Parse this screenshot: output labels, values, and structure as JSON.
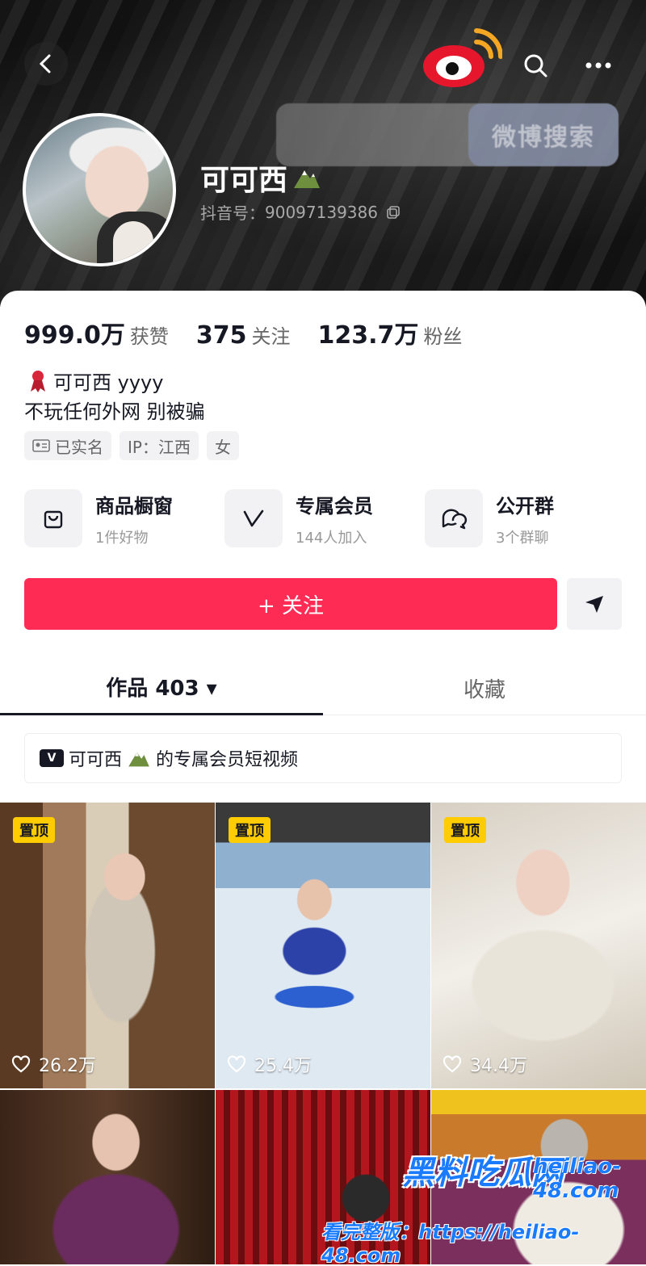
{
  "header": {
    "weibo_search_label": "微博搜索",
    "username": "可可西",
    "douyin_id_label": "抖音号：",
    "douyin_id": "90097139386"
  },
  "stats": [
    {
      "num": "999.0万",
      "label": "获赞"
    },
    {
      "num": "375",
      "label": "关注"
    },
    {
      "num": "123.7万",
      "label": "粉丝"
    }
  ],
  "bio": {
    "line1": "可可西 yyyy",
    "line2": "不玩任何外网 别被骗"
  },
  "tags": [
    "已实名",
    "IP：江西",
    "女"
  ],
  "features": [
    {
      "title": "商品橱窗",
      "sub": "1件好物",
      "icon": "shopping-bag-icon"
    },
    {
      "title": "专属会员",
      "sub": "144人加入",
      "icon": "vip-v-icon"
    },
    {
      "title": "公开群",
      "sub": "3个群聊",
      "icon": "chat-group-icon"
    }
  ],
  "actions": {
    "follow_label": "+ 关注"
  },
  "tabs": {
    "works": "作品 403 ▾",
    "favorites": "收藏"
  },
  "member_banner": {
    "badge": "V",
    "name": "可可西",
    "suffix": "的专属会员短视频"
  },
  "videos": [
    {
      "pinned": "置顶",
      "likes": "26.2万"
    },
    {
      "pinned": "置顶",
      "likes": "25.4万"
    },
    {
      "pinned": "置顶",
      "likes": "34.4万"
    },
    {
      "pinned": "",
      "likes": ""
    },
    {
      "pinned": "",
      "likes": ""
    },
    {
      "pinned": "",
      "likes": ""
    }
  ],
  "watermark": {
    "title": "黑料吃瓜网",
    "domain": "heiliao-48.com",
    "full": "看完整版：https://heiliao-48.com"
  },
  "colors": {
    "accent": "#fe2c55",
    "pin": "#fecc00",
    "watermark": "#1a7bff"
  }
}
